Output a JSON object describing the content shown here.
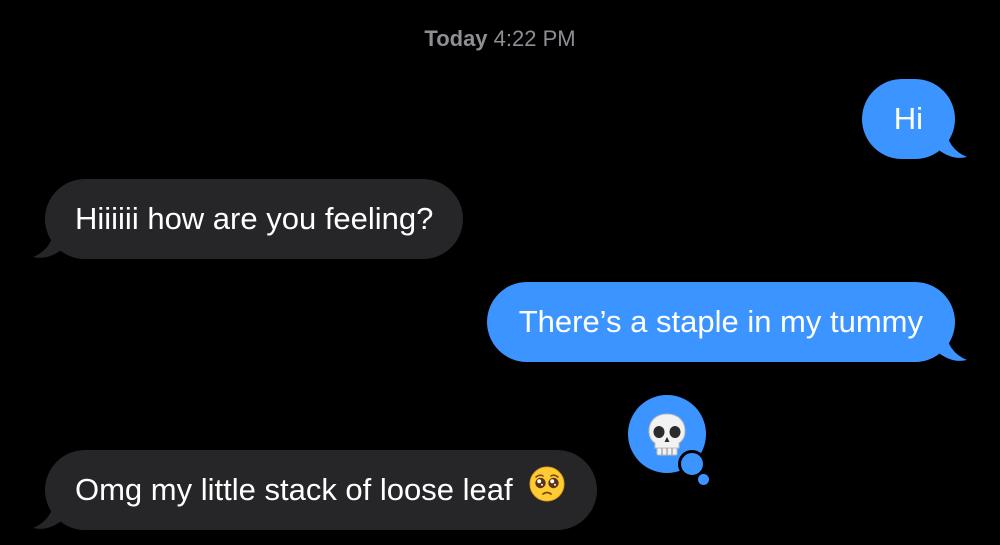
{
  "thread": {
    "timestamp_day": "Today",
    "timestamp_time": "4:22 PM"
  },
  "messages": [
    {
      "direction": "sent",
      "text": "Hi"
    },
    {
      "direction": "received",
      "text": "Hiiiiii how are you feeling?"
    },
    {
      "direction": "sent",
      "text": "There’s a staple in my tummy"
    },
    {
      "direction": "received",
      "text": "Omg my little stack of loose leaf",
      "trailing_emoji": "pleading-face-icon"
    }
  ],
  "tapback": {
    "emoji": "skull-icon",
    "on_message": 3
  },
  "colors": {
    "sent_bubble": "#3b94ff",
    "received_bubble": "#262628",
    "background": "#000000",
    "timestamp": "#8e8e93"
  }
}
